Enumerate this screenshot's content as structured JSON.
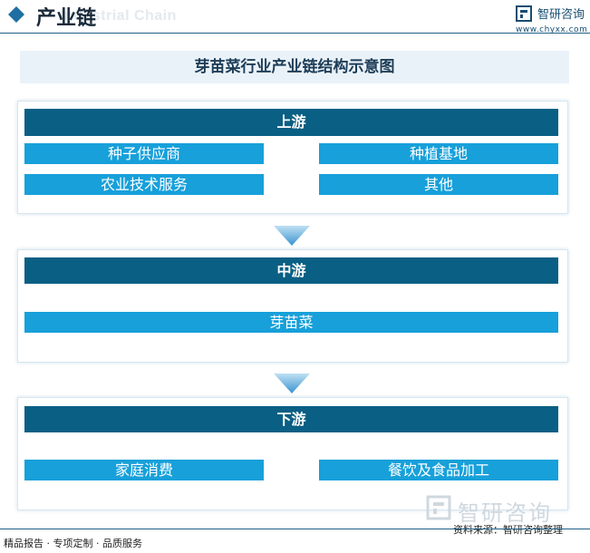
{
  "header": {
    "title": "产业链",
    "subtitle": "Industrial Chain",
    "brand_name": "智研咨询",
    "brand_url": "www.chyxx.com"
  },
  "diagram": {
    "title": "芽苗菜行业产业链结构示意图",
    "stages": [
      {
        "name": "上游",
        "items": [
          "种子供应商",
          "种植基地",
          "农业技术服务",
          "其他"
        ]
      },
      {
        "name": "中游",
        "items": [
          "芽苗菜"
        ]
      },
      {
        "name": "下游",
        "items": [
          "家庭消费",
          "餐饮及食品加工"
        ]
      }
    ]
  },
  "footer": {
    "left_text": "精品报告 · 专项定制 · 品质服务",
    "source_text": "资料来源：智研咨询整理",
    "watermark_text": "智研咨询"
  },
  "colors": {
    "stage_header": "#0a5f84",
    "item_bar": "#17a0da",
    "arrow": "#4a9fd4",
    "accent_dark": "#1f5f86"
  }
}
